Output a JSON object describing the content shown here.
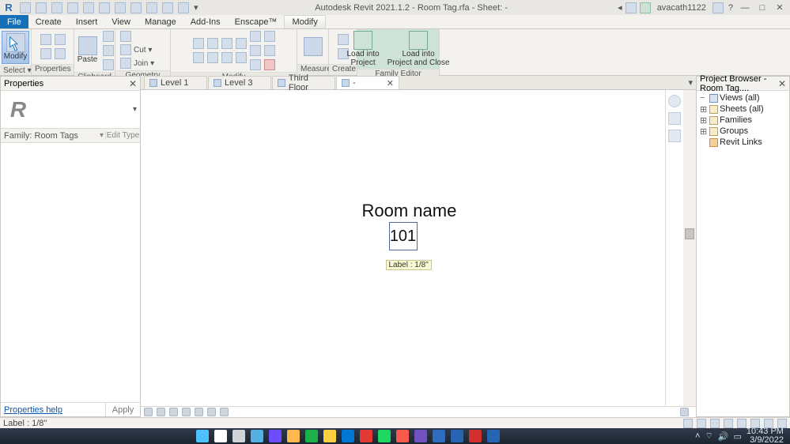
{
  "title": "Autodesk Revit 2021.1.2 - Room Tag.rfa - Sheet:  -",
  "user": "avacath1122",
  "ribbon_tabs": [
    "File",
    "Create",
    "Insert",
    "View",
    "Manage",
    "Add-Ins",
    "Enscape™",
    "Modify"
  ],
  "ribbon": {
    "select_label": "Select ▾",
    "properties_label": "Properties",
    "clipboard_label": "Clipboard",
    "paste_label": "Paste",
    "cut_label": "Cut ▾",
    "join_label": "Join ▾",
    "geometry_label": "Geometry",
    "modify_label": "Modify",
    "measure_label": "Measure",
    "create_label": "Create",
    "load_project": "Load into\nProject",
    "load_project_close": "Load into\nProject and Close",
    "family_editor_label": "Family Editor",
    "select_btn": "Modify"
  },
  "properties": {
    "title": "Properties",
    "family": "Family: Room Tags",
    "edittype": "Edit Type",
    "help": "Properties help",
    "apply": "Apply"
  },
  "views": {
    "t1": "Level 1",
    "t2": "Level 3",
    "t3": "Third Floor",
    "t4": "  -"
  },
  "canvas": {
    "room_name": "Room name",
    "room_number": "101",
    "label_tag": "Label : 1/8\""
  },
  "browser": {
    "title": "Project Browser - Room Tag....",
    "views": "Views (all)",
    "sheets": "Sheets (all)",
    "families": "Families",
    "groups": "Groups",
    "revitlinks": "Revit Links"
  },
  "status_left": "Label : 1/8\"",
  "clock": {
    "time": "10:43 PM",
    "date": "3/9/2022"
  },
  "task_colors": [
    "#4cc2ff",
    "#ffffff",
    "#d0d4d9",
    "#56b0e4",
    "#6a4cfc",
    "#ffb84d",
    "#1cb04a",
    "#ffcf3f",
    "#0078d4",
    "#e53935",
    "#1ed760",
    "#f7594a",
    "#7252c1",
    "#2f6cbf",
    "#2864b4",
    "#d32f2f",
    "#2864b4"
  ]
}
